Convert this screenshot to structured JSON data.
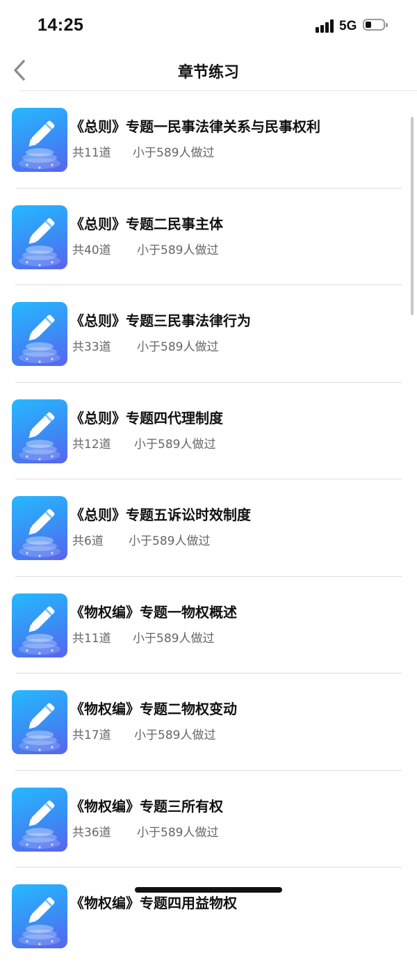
{
  "status_bar": {
    "time": "14:25",
    "network": "5G"
  },
  "nav": {
    "title": "章节练习",
    "back_icon": "chevron-left-icon"
  },
  "chapters": [
    {
      "title": "《总则》专题一民事法律关系与民事权利",
      "count": "共11道",
      "users": "小于589人做过"
    },
    {
      "title": "《总则》专题二民事主体",
      "count": "共40道",
      "users": "小于589人做过"
    },
    {
      "title": "《总则》专题三民事法律行为",
      "count": "共33道",
      "users": "小于589人做过"
    },
    {
      "title": "《总则》专题四代理制度",
      "count": "共12道",
      "users": "小于589人做过"
    },
    {
      "title": "《总则》专题五诉讼时效制度",
      "count": "共6道",
      "users": "小于589人做过"
    },
    {
      "title": "《物权编》专题一物权概述",
      "count": "共11道",
      "users": "小于589人做过"
    },
    {
      "title": "《物权编》专题二物权变动",
      "count": "共17道",
      "users": "小于589人做过"
    },
    {
      "title": "《物权编》专题三所有权",
      "count": "共36道",
      "users": "小于589人做过"
    },
    {
      "title": "《物权编》专题四用益物权",
      "count": "",
      "users": ""
    }
  ],
  "colors": {
    "thumb_start": "#25b9ff",
    "thumb_end": "#5a63ee",
    "meta_text": "#666666",
    "divider": "#dcdcdc"
  }
}
